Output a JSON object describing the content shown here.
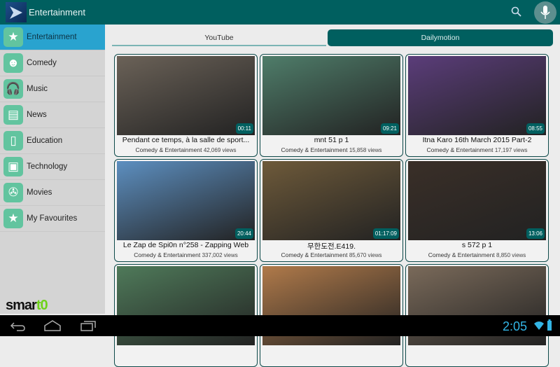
{
  "app": {
    "title": "Entertainment"
  },
  "sidebar": {
    "items": [
      {
        "label": "Entertainment",
        "icon": "star-icon",
        "glyph": "★",
        "selected": true
      },
      {
        "label": "Comedy",
        "icon": "comedy-mask-icon",
        "glyph": "☻"
      },
      {
        "label": "Music",
        "icon": "headphones-icon",
        "glyph": "🎧"
      },
      {
        "label": "News",
        "icon": "newspaper-icon",
        "glyph": "▤"
      },
      {
        "label": "Education",
        "icon": "book-icon",
        "glyph": "▯"
      },
      {
        "label": "Technology",
        "icon": "chip-icon",
        "glyph": "▣"
      },
      {
        "label": "Movies",
        "icon": "film-reel-icon",
        "glyph": "✇"
      },
      {
        "label": "My Favourites",
        "icon": "star-icon",
        "glyph": "★"
      }
    ],
    "brand": {
      "a": "smar",
      "b": "t0"
    }
  },
  "tabs": [
    {
      "label": "YouTube"
    },
    {
      "label": "Dailymotion",
      "active": true
    }
  ],
  "videos": [
    {
      "title": "Pendant ce temps, à la salle de sport...",
      "category": "Comedy & Entertainment",
      "views": "42,069 views",
      "duration": "00:11",
      "color": "#6b6258"
    },
    {
      "title": "mnt 51 p 1",
      "category": "Comedy & Entertainment",
      "views": "15,858 views",
      "duration": "09:21",
      "color": "#4f7d6a"
    },
    {
      "title": "Itna Karo 16th March 2015 Part-2",
      "category": "Comedy & Entertainment",
      "views": "17,197 views",
      "duration": "08:55",
      "color": "#5b3d7a"
    },
    {
      "title": "Le Zap de Spi0n n°258 - Zapping Web",
      "category": "Comedy & Entertainment",
      "views": "337,002 views",
      "duration": "20:44",
      "color": "#5d8fc0"
    },
    {
      "title": "무한도전.E419.",
      "category": "Comedy & Entertainment",
      "views": "85,670 views",
      "duration": "01:17:09",
      "color": "#6e5a3a"
    },
    {
      "title": "s 572 p 1",
      "category": "Comedy & Entertainment",
      "views": "8,850 views",
      "duration": "13:06",
      "color": "#3a2f28"
    },
    {
      "title": "",
      "category": "",
      "views": "",
      "duration": "",
      "color": "#4f7a5a"
    },
    {
      "title": "",
      "category": "",
      "views": "",
      "duration": "",
      "color": "#b07a4a"
    },
    {
      "title": "",
      "category": "",
      "views": "",
      "duration": "",
      "color": "#7a6a5a"
    }
  ],
  "status": {
    "time": "2:05"
  }
}
